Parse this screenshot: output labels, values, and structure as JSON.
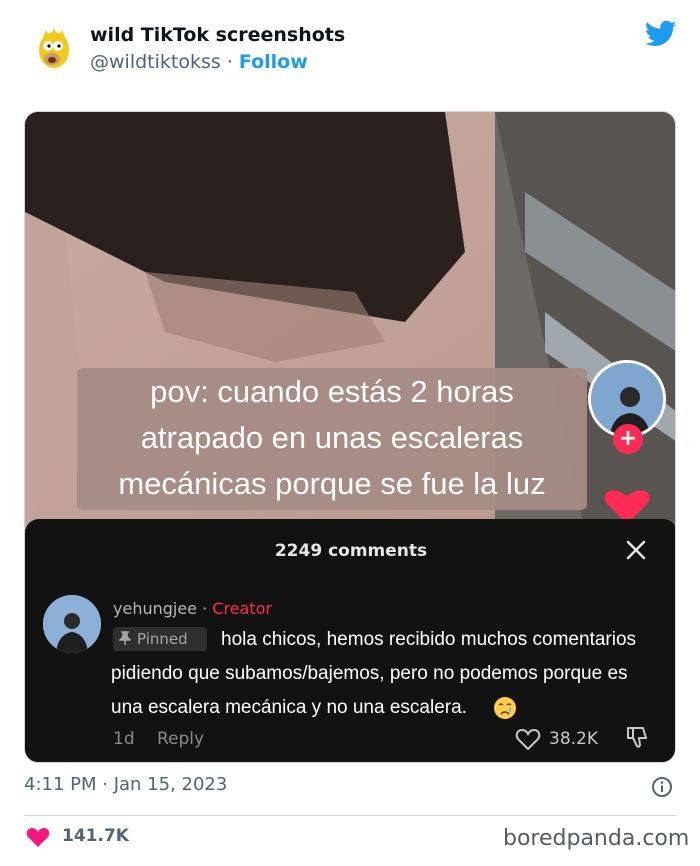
{
  "tweet": {
    "author_name": "wild TikTok screenshots",
    "handle": "@wildtiktokss",
    "separator": " · ",
    "follow_label": "Follow",
    "timestamp": "4:11 PM · Jan 15, 2023",
    "likes": "141.7K"
  },
  "video": {
    "caption_lines": [
      "pov: cuando estás 2 horas",
      "atrapado en unas escaleras",
      "mecánicas porque se fue la luz"
    ],
    "plus_label": "+"
  },
  "comments_panel": {
    "count_label": "2249 comments",
    "comment": {
      "username": "yehungjee",
      "separator": " · ",
      "creator_badge": "Creator",
      "pinned_label": "Pinned",
      "text_lines": [
        "hola chicos, hemos recibido muchos comentarios",
        "pidiendo que subamos/bajemos, pero no podemos porque es",
        "una escalera mecánica y no una escalera."
      ],
      "age": "1d",
      "reply_label": "Reply",
      "like_count": "38.2K"
    }
  },
  "watermark": "boredpanda.com",
  "colors": {
    "twitter_blue": "#1d9bf0",
    "tiktok_red": "#fe2c55",
    "panel_bg": "#121212",
    "like_pink": "#f91880"
  },
  "icons": {
    "twitter": "twitter-bird-icon",
    "close": "close-icon",
    "pin": "pin-icon",
    "cry": "crying-face-emoji-icon",
    "heart": "heart-icon",
    "dislike": "thumbs-down-icon",
    "info": "info-icon"
  }
}
